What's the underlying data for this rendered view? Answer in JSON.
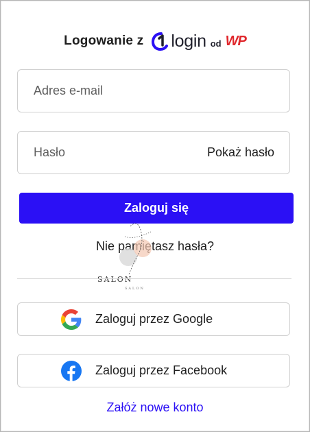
{
  "header": {
    "prefix": "Logowanie z",
    "brand_login": "login",
    "brand_od": "od",
    "brand_wp": "WP"
  },
  "form": {
    "email_placeholder": "Adres e-mail",
    "password_placeholder": "Hasło",
    "show_password_label": "Pokaż hasło",
    "submit_label": "Zaloguj się",
    "forgot_label": "Nie pamiętasz hasła?"
  },
  "watermark": {
    "text": "SALON",
    "subtext": "SALON"
  },
  "social": {
    "google_label": "Zaloguj przez Google",
    "facebook_label": "Zaloguj przez Facebook"
  },
  "footer": {
    "register_label": "Załóż nowe konto"
  },
  "colors": {
    "accent": "#2b10f5",
    "wp_red": "#e0282d",
    "facebook_blue": "#1877f2"
  }
}
